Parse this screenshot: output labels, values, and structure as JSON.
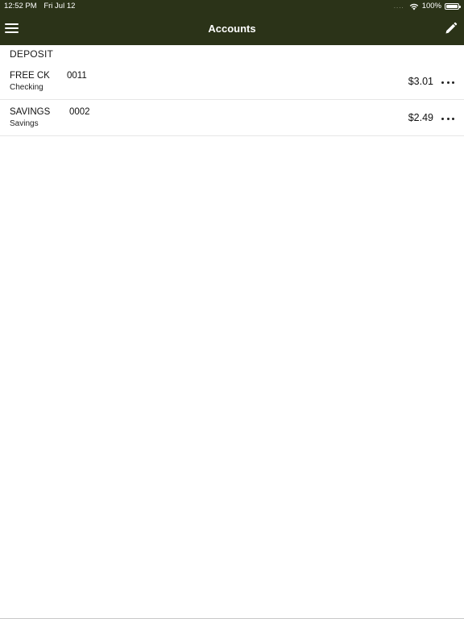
{
  "status_bar": {
    "time": "12:52 PM",
    "date": "Fri Jul 12",
    "signal": "....",
    "wifi_icon": "wifi-icon",
    "battery": "100%",
    "battery_icon": "battery-icon"
  },
  "nav": {
    "title": "Accounts",
    "menu_icon": "hamburger-menu-icon",
    "edit_icon": "pencil-icon",
    "background_color": "#2b3318"
  },
  "sections": [
    {
      "header": "DEPOSIT",
      "accounts": [
        {
          "name": "FREE CK",
          "number": "0011",
          "type": "Checking",
          "balance": "$3.01"
        },
        {
          "name": "SAVINGS",
          "number": "0002",
          "type": "Savings",
          "balance": "$2.49"
        }
      ]
    }
  ]
}
